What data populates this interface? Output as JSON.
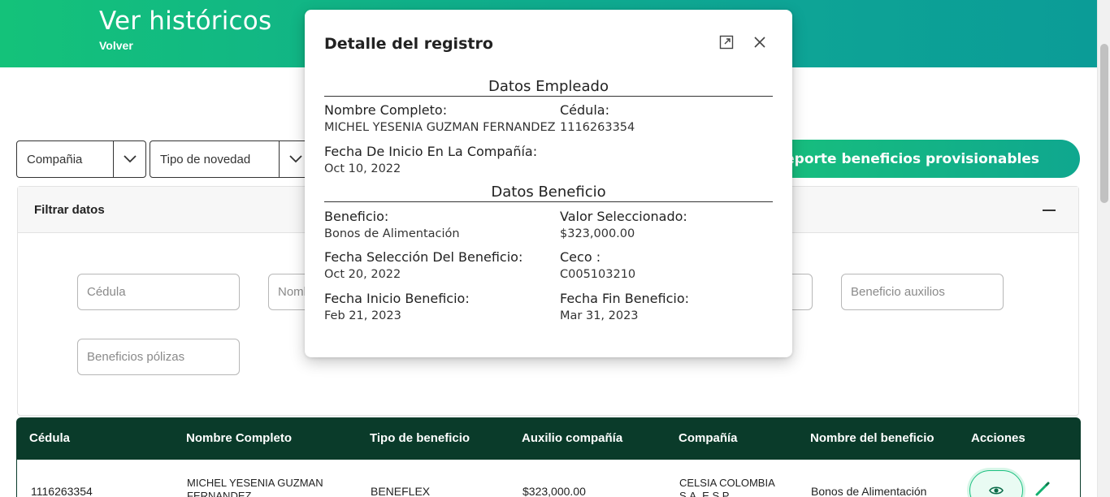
{
  "header": {
    "title": "Ver históricos",
    "back_label": "Volver"
  },
  "toolbar": {
    "company_select": "Compañia",
    "novelty_select": "Tipo de novedad",
    "report_button": "reporte beneficios provisionables"
  },
  "filter": {
    "title": "Filtrar datos",
    "placeholders": {
      "cedula": "Cédula",
      "nombre": "Nombre",
      "aux_benefit": "Beneficio auxilios",
      "policy_benefit": "Beneficios pólizas"
    }
  },
  "table": {
    "headers": [
      "Cédula",
      "Nombre Completo",
      "Tipo de beneficio",
      "Auxilio compañía",
      "Compañía",
      "Nombre del beneficio",
      "Acciones"
    ],
    "rows": [
      {
        "cedula": "1116263354",
        "nombre_1": "MICHEL YESENIA GUZMAN",
        "nombre_2": "FERNANDEZ",
        "tipo": "BENEFLEX",
        "auxilio": "$323,000.00",
        "compania_1": "CELSIA COLOMBIA",
        "compania_2": "S.A. E.S.P.",
        "beneficio": "Bonos de Alimentación"
      }
    ]
  },
  "modal": {
    "title": "Detalle del registro",
    "employee_section": "Datos Empleado",
    "employee": {
      "full_name_label": "Nombre Completo:",
      "full_name": "MICHEL YESENIA GUZMAN FERNANDEZ",
      "id_label": "Cédula:",
      "id": "1116263354",
      "start_label": "Fecha De Inicio En La Compañía:",
      "start": "Oct 10, 2022"
    },
    "benefit_section": "Datos Beneficio",
    "benefit": {
      "benefit_label": "Beneficio:",
      "benefit": "Bonos de Alimentación",
      "value_label": "Valor Seleccionado:",
      "value": "$323,000.00",
      "selection_date_label": "Fecha Selección Del Beneficio:",
      "selection_date": "Oct 20, 2022",
      "ceco_label": "Ceco :",
      "ceco": "C005103210",
      "start_label": "Fecha Inicio Beneficio:",
      "start": "Feb 21, 2023",
      "end_label": "Fecha Fin Beneficio:",
      "end": "Mar 31, 2023"
    }
  },
  "icons": {
    "expand": "expand-icon",
    "close": "close-icon",
    "caret": "chevron-down-icon",
    "view": "eye-icon",
    "edit": "pencil-icon",
    "collapse": "minus-icon"
  },
  "colors": {
    "header_start": "#14c27a",
    "header_end": "#0b9c97",
    "table_header": "#0a3b2a",
    "accent": "#1cc080"
  }
}
